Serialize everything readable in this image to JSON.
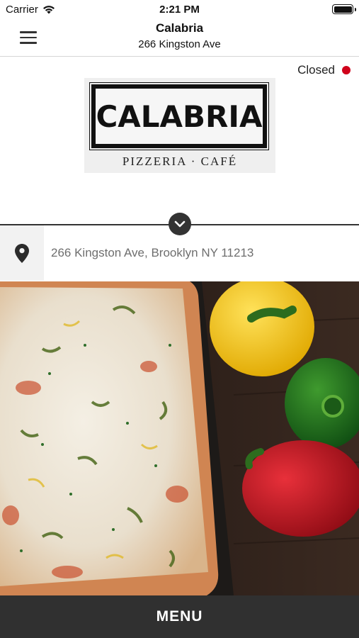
{
  "status_bar": {
    "carrier": "Carrier",
    "time": "2:21 PM"
  },
  "nav": {
    "title": "Calabria",
    "subtitle": "266 Kingston Ave"
  },
  "store_status": {
    "label": "Closed",
    "color": "#d0021b"
  },
  "logo": {
    "name": "CALABRIA",
    "tagline": "PIZZERIA · CAFÉ"
  },
  "location": {
    "address": "266 Kingston Ave, Brooklyn NY 11213",
    "icon": "map-pin-icon"
  },
  "footer": {
    "menu_label": "MENU"
  },
  "colors": {
    "bar": "#303030",
    "closed_dot": "#d0021b"
  }
}
